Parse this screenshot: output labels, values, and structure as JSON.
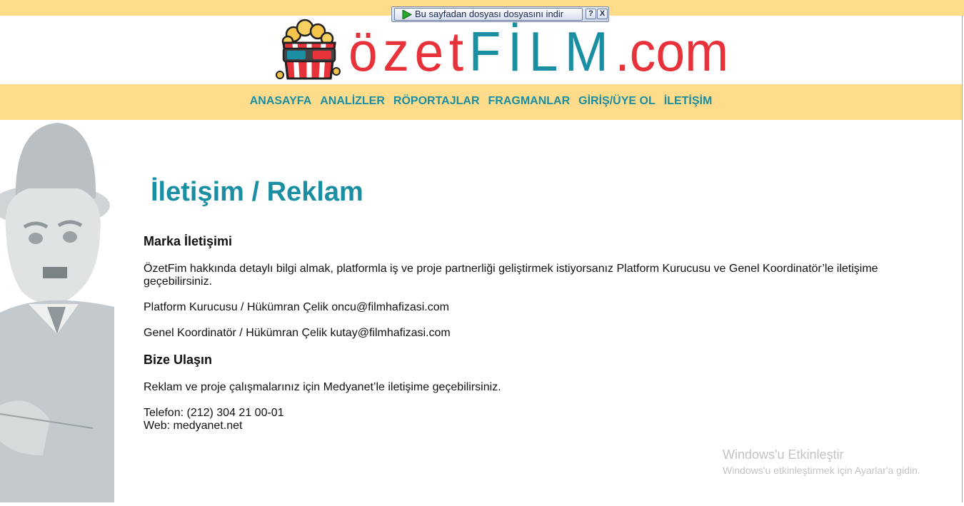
{
  "download_bar": {
    "label": "Bu sayfadan dosyası dosyasını indir",
    "help_label": "?",
    "close_label": "X"
  },
  "logo": {
    "part1": "özet",
    "part2": "FİLM",
    "part3": ".com"
  },
  "nav": {
    "items": [
      "ANASAYFA",
      "ANALİZLER",
      "RÖPORTAJLAR",
      "FRAGMANLAR",
      "GİRİŞ/ÜYE OL",
      "İLETİŞİM"
    ]
  },
  "page": {
    "title": "İletişim / Reklam",
    "section1_heading": "Marka İletişimi",
    "section1_intro": "ÖzetFim hakkında detaylı bilgi almak, platformla iş ve proje partnerliği geliştirmek istiyorsanız Platform Kurucusu ve Genel Koordinatör’le iletişime geçebilirsiniz.",
    "contact1": "Platform Kurucusu / Hükümran Çelik oncu@filmhafizasi.com",
    "contact2": "Genel Koordinatör / Hükümran Çelik kutay@filmhafizasi.com",
    "section2_heading": "Bize Ulaşın",
    "section2_intro": "Reklam ve proje çalışmalarınız için Medyanet’le iletişime geçebilirsiniz.",
    "phone": "Telefon: (212) 304 21 00-01",
    "web": "Web: medyanet.net"
  },
  "watermark": {
    "title": "Windows'u Etkinleştir",
    "subtitle": "Windows'u etkinleştirmek için Ayarlar'a gidin."
  },
  "colors": {
    "accent_teal": "#1a8ea3",
    "logo_red": "#e8323a",
    "nav_background": "#fedc8c"
  }
}
